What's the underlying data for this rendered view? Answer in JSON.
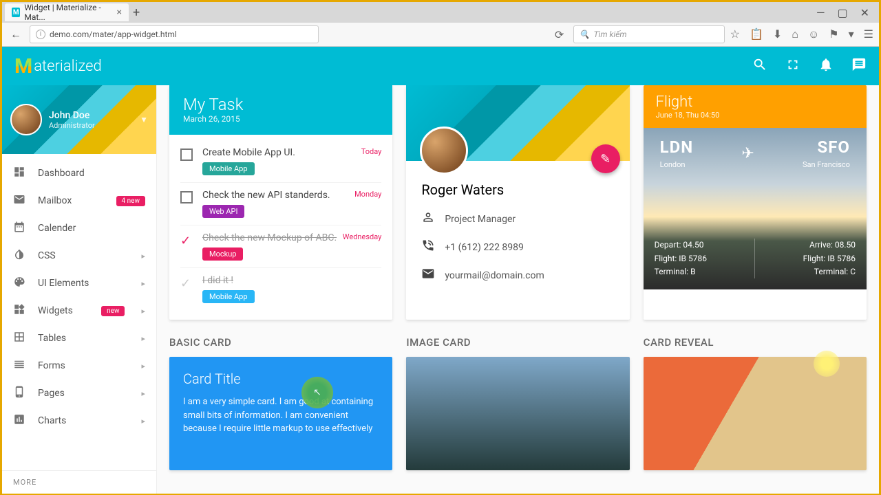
{
  "browser": {
    "tab_title": "Widget | Materialize - Mat...",
    "url": "demo.com/mater/app-widget.html",
    "search_placeholder": "Tìm kiếm"
  },
  "brand": "aterialized",
  "profile_sidebar": {
    "name": "John Doe",
    "role": "Administrator"
  },
  "nav": [
    {
      "label": "Dashboard"
    },
    {
      "label": "Mailbox",
      "badge": "4 new"
    },
    {
      "label": "Calender"
    },
    {
      "label": "CSS",
      "chev": true
    },
    {
      "label": "UI Elements",
      "chev": true
    },
    {
      "label": "Widgets",
      "badge": "new",
      "chev": true
    },
    {
      "label": "Tables",
      "chev": true
    },
    {
      "label": "Forms",
      "chev": true
    },
    {
      "label": "Pages",
      "chev": true
    },
    {
      "label": "Charts",
      "chev": true
    }
  ],
  "more_label": "MORE",
  "task": {
    "title": "My Task",
    "date": "March 26, 2015",
    "items": [
      {
        "title": "Create Mobile App UI.",
        "tag": "Mobile App",
        "tag_color": "#26a69a",
        "when": "Today"
      },
      {
        "title": "Check the new API standerds.",
        "tag": "Web API",
        "tag_color": "#9c27b0",
        "when": "Monday"
      },
      {
        "title": "Check the new Mockup of ABC.",
        "tag": "Mockup",
        "tag_color": "#e91e63",
        "when": "Wednesday",
        "done": true
      },
      {
        "title": "I did it !",
        "tag": "Mobile App",
        "tag_color": "#29b6f6",
        "done2": true
      }
    ]
  },
  "contact": {
    "name": "Roger Waters",
    "role": "Project Manager",
    "phone": "+1 (612) 222 8989",
    "email": "yourmail@domain.com"
  },
  "flight": {
    "title": "Flight",
    "sub": "June 18, Thu 04:50",
    "from_code": "LDN",
    "from_city": "London",
    "to_code": "SFO",
    "to_city": "San Francisco",
    "depart_l1": "Depart: 04.50",
    "depart_l2": "Flight: IB 5786",
    "depart_l3": "Terminal: B",
    "arrive_l1": "Arrive: 08.50",
    "arrive_l2": "Flight: IB 5786",
    "arrive_l3": "Terminal: C"
  },
  "sections": {
    "basic": "BASIC CARD",
    "image": "IMAGE CARD",
    "reveal": "CARD REVEAL",
    "card_title": "Card Title",
    "card_text": "I am a very simple card. I am good at containing small bits of information. I am convenient because I require little markup to use effectively"
  }
}
